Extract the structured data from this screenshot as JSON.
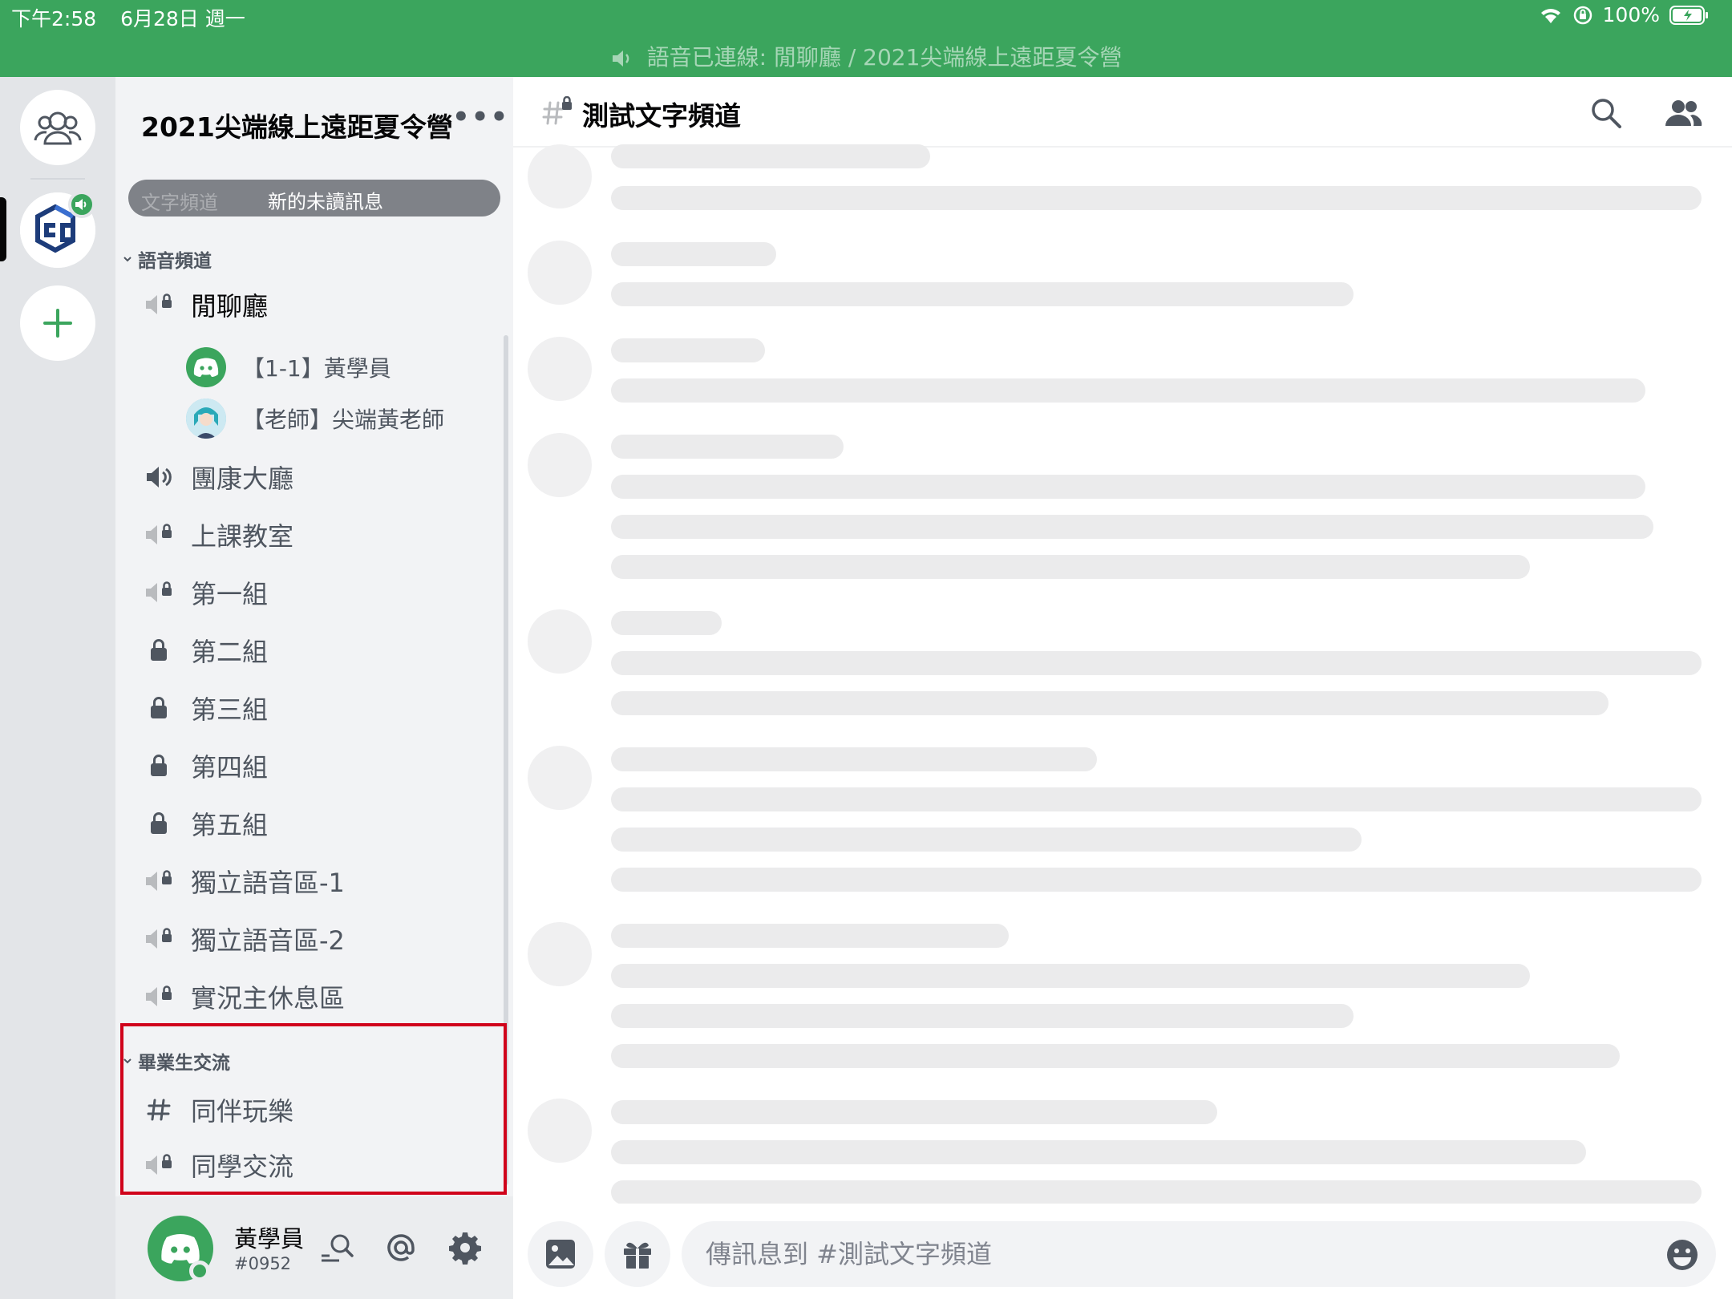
{
  "status_bar": {
    "time": "下午2:58",
    "date": "6月28日 週一",
    "battery": "100%",
    "voice_banner": "語音已連線: 閒聊廳 / 2021尖端線上遠距夏令營"
  },
  "server": {
    "name": "2021尖端線上遠距夏令營",
    "more": "•••"
  },
  "unread": {
    "category": "文字頻道",
    "label": "新的未讀訊息"
  },
  "categories": [
    {
      "name": "語音頻道"
    },
    {
      "name": "畢業生交流"
    }
  ],
  "channels": [
    {
      "name": "閒聊廳",
      "icon": "voice-locked-icon"
    },
    {
      "name": "團康大廳",
      "icon": "speaker-icon"
    },
    {
      "name": "上課教室",
      "icon": "voice-locked-icon"
    },
    {
      "name": "第一組",
      "icon": "voice-locked-icon"
    },
    {
      "name": "第二組",
      "icon": "lock-icon"
    },
    {
      "name": "第三組",
      "icon": "lock-icon"
    },
    {
      "name": "第四組",
      "icon": "lock-icon"
    },
    {
      "name": "第五組",
      "icon": "lock-icon"
    },
    {
      "name": "獨立語音區-1",
      "icon": "voice-locked-icon"
    },
    {
      "name": "獨立語音區-2",
      "icon": "voice-locked-icon"
    },
    {
      "name": "實況主休息區",
      "icon": "voice-locked-icon"
    },
    {
      "name": "同伴玩樂",
      "icon": "hash-icon"
    },
    {
      "name": "同學交流",
      "icon": "voice-locked-icon"
    }
  ],
  "voice_users": [
    {
      "name": "【1-1】黃學員"
    },
    {
      "name": "【老師】尖端黃老師"
    }
  ],
  "user": {
    "name": "黃學員",
    "tag": "#0952"
  },
  "main": {
    "channel_title": "測試文字頻道",
    "composer_placeholder": "傳訊息到 #測試文字頻道"
  },
  "colors": {
    "brand_green": "#3ba55d",
    "highlight_red": "#d0021b",
    "blurple": "#5865f2"
  }
}
